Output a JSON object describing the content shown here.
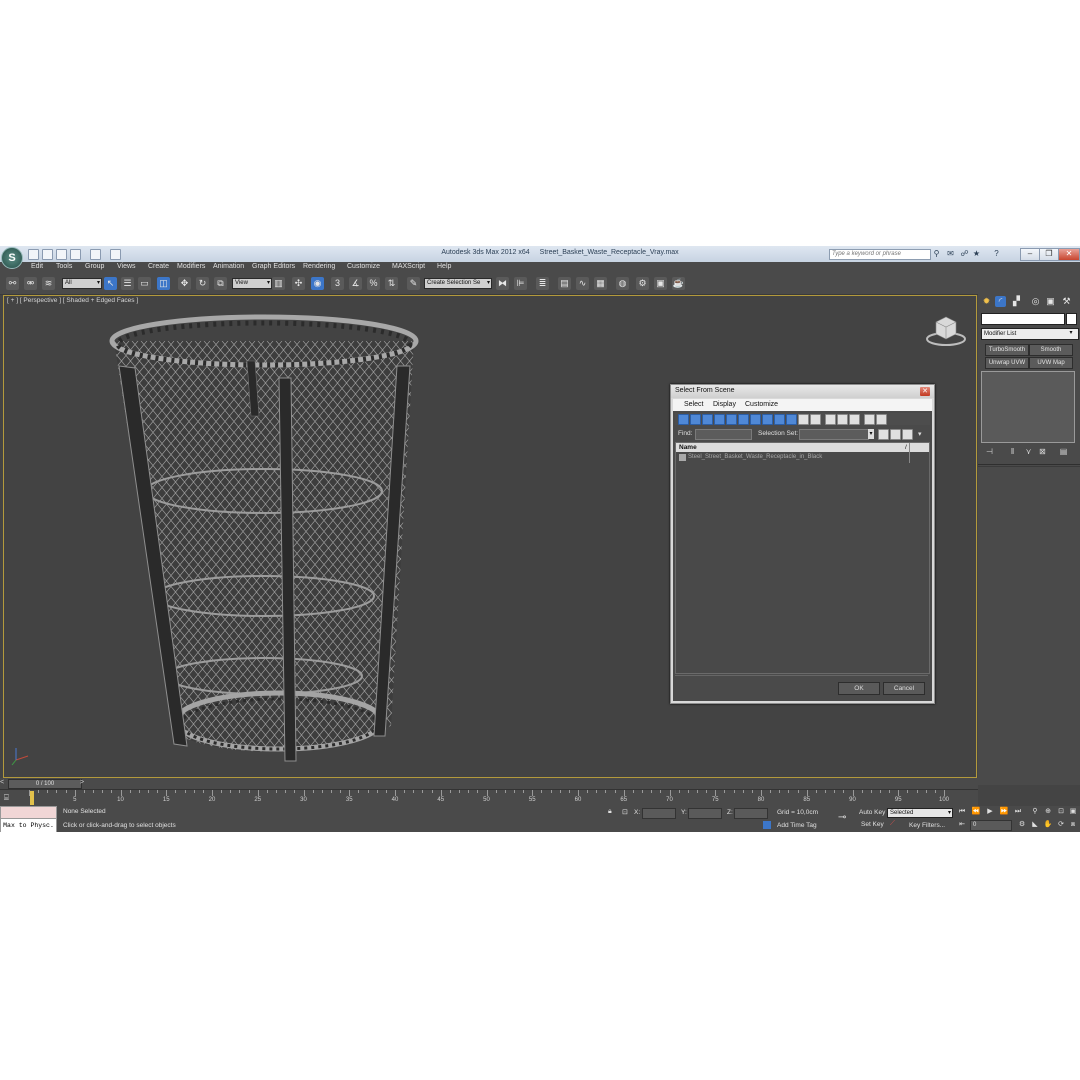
{
  "titlebar": {
    "app": "Autodesk 3ds Max  2012 x64",
    "file": "Street_Basket_Waste_Receptacle_Vray.max",
    "search_placeholder": "Type a keyword or phrase"
  },
  "menu": [
    "Edit",
    "Tools",
    "Group",
    "Views",
    "Create",
    "Modifiers",
    "Animation",
    "Graph Editors",
    "Rendering",
    "Customize",
    "MAXScript",
    "Help"
  ],
  "toolbar": {
    "filter": "All",
    "ref_coord": "View",
    "num3": "3",
    "pct": "%",
    "selection_set": "Create Selection Se"
  },
  "viewport": {
    "label": "[ + ] [ Perspective ] [ Shaded + Edged Faces ]"
  },
  "command_panel": {
    "modifier_list": "Modifier List",
    "buttons": [
      "TurboSmooth",
      "Smooth",
      "Unwrap UVW",
      "UVW Map"
    ]
  },
  "dialog": {
    "title": "Select From Scene",
    "menu": [
      "Select",
      "Display",
      "Customize"
    ],
    "find_label": "Find:",
    "selection_set_label": "Selection Set:",
    "col_name": "Name",
    "col_sort": "/",
    "rows": [
      "Steel_Street_Basket_Waste_Receptacle_in_Black"
    ],
    "ok": "OK",
    "cancel": "Cancel"
  },
  "timeline": {
    "frame": "0 / 100",
    "ticks": [
      "5",
      "10",
      "15",
      "20",
      "25",
      "30",
      "35",
      "40",
      "45",
      "50",
      "55",
      "60",
      "65",
      "70",
      "75",
      "80",
      "85",
      "90",
      "95",
      "100"
    ]
  },
  "status": {
    "maxscript": "Max to Physc.",
    "selection": "None Selected",
    "prompt": "Click or click-and-drag to select objects",
    "x_label": "X:",
    "y_label": "Y:",
    "z_label": "Z:",
    "grid": "Grid = 10,0cm",
    "add_time_tag": "Add Time Tag",
    "auto_key": "Auto Key",
    "set_key": "Set Key",
    "selected": "Selected",
    "key_filters": "Key Filters...",
    "frame_field": "0"
  },
  "colors": {
    "accent": "#3c76c8",
    "viewport_border": "#b39a3c",
    "ui_bg": "#4a4a4a"
  }
}
